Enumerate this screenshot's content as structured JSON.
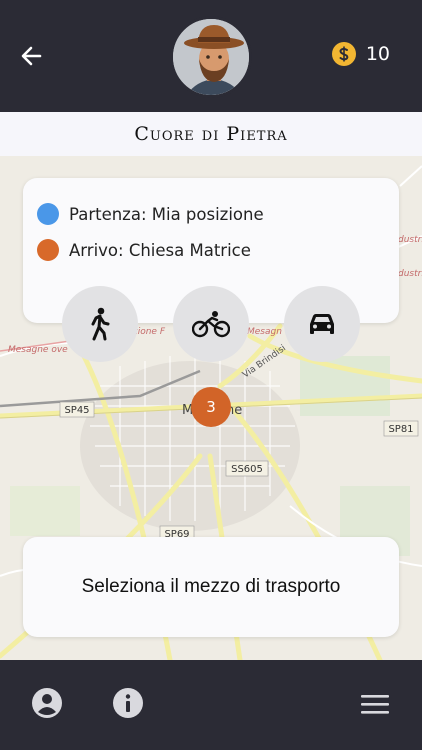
{
  "header": {
    "back_icon": "arrow-left-icon",
    "avatar_icon": "explorer-avatar",
    "coin_icon": "dollar-coin-icon",
    "coin_count": "10"
  },
  "title": "Cuore di Pietra",
  "route": {
    "start": "Partenza: Mia posizione",
    "end": "Arrivo: Chiesa Matrice",
    "start_color": "#4a97e8",
    "end_color": "#d8692a"
  },
  "modes": [
    {
      "icon": "walking-icon"
    },
    {
      "icon": "bicycle-icon"
    },
    {
      "icon": "car-icon"
    }
  ],
  "map": {
    "cluster_count": "3",
    "labels": {
      "sp45": "SP45",
      "sp81": "SP81",
      "ss605": "SS605",
      "sp69": "SP69",
      "via_brindisi": "Via Brindisi",
      "town": "Me...ne",
      "mesagne_ovest": "Mesagne ovest",
      "stazione": "Stazione F...",
      "mesagn": "Mesagn..."
    }
  },
  "prompt": "Seleziona il mezzo di trasporto",
  "bottom_nav": {
    "profile_icon": "user-circle-icon",
    "info_icon": "info-icon",
    "menu_icon": "hamburger-menu-icon"
  }
}
